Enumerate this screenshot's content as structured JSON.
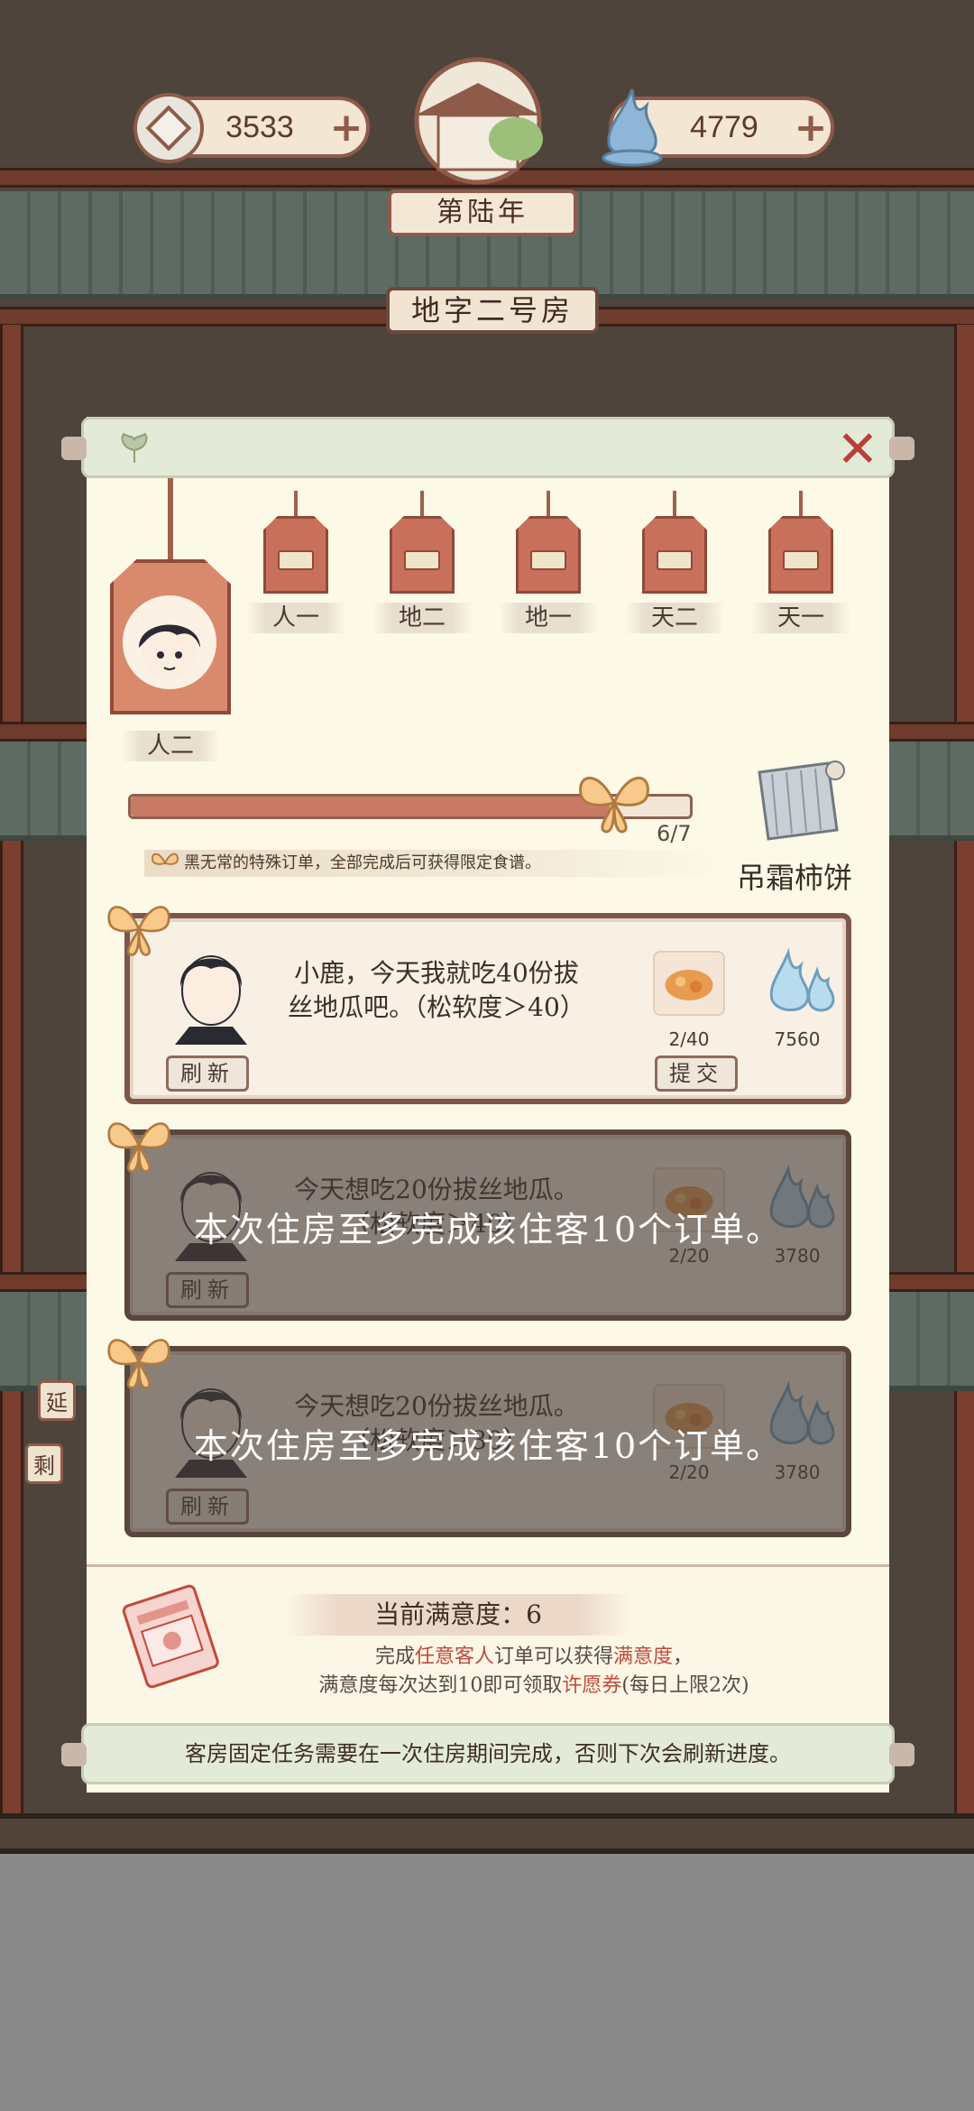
{
  "hud": {
    "coins": "3533",
    "souls": "4779",
    "year": "第陆年",
    "room": "地字二号房"
  },
  "side": {
    "tag_1": "延",
    "tag_2": "剩"
  },
  "modal": {
    "current_tier": "人二",
    "tiers": [
      "人一",
      "地二",
      "地一",
      "天二",
      "天一"
    ],
    "progress_text": "6/7",
    "progress_value": 0.857,
    "note": "黑无常的特殊订单，全部完成后可获得限定食谱。",
    "reward_name": "吊霜柿饼",
    "orders": [
      {
        "text": "小鹿，今天我就吃40份拔丝地瓜吧。（松软度＞40）",
        "count": "2/40",
        "reward": "7560",
        "refresh": "刷新",
        "submit": "提交"
      },
      {
        "text": "今天想吃20份拔丝地瓜。（松软度＞40）",
        "count": "2/20",
        "reward": "3780",
        "refresh": "刷新",
        "lock_msg": "本次住房至多完成该住客10个订单。"
      },
      {
        "text": "今天想吃20份拔丝地瓜。（松软度＞30）",
        "count": "2/20",
        "reward": "3780",
        "refresh": "刷新",
        "lock_msg": "本次住房至多完成该住客10个订单。"
      }
    ],
    "satisfaction_title": "当前满意度：6",
    "sat_line1_a": "完成",
    "sat_line1_b": "任意客人",
    "sat_line1_c": "订单可以获得",
    "sat_line1_d": "满意度",
    "sat_line1_e": "，",
    "sat_line2_a": "满意度每次达到10即可领取",
    "sat_line2_b": "许愿券",
    "sat_line2_c": "(每日上限2次)",
    "footer": "客房固定任务需要在一次住房期间完成，否则下次会刷新进度。"
  },
  "colors": {
    "accent_red": "#c24a3c",
    "tag_red": "#c9705c",
    "paper": "#fcf9e6",
    "frame_brown": "#7d5749"
  }
}
